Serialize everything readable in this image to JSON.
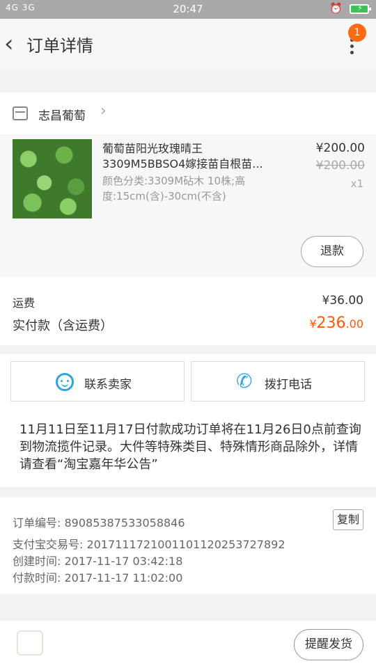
{
  "status_bar": {
    "signal": "4G 3G",
    "time": "20:47"
  },
  "header": {
    "title": "订单详情",
    "badge": "1"
  },
  "shop": {
    "name": "志昌葡萄"
  },
  "product": {
    "name": "葡萄苗阳光玫瑰晴王3309M5BBSO4嫁接苗自根苗...",
    "spec": "颜色分类:3309M砧木 10株;高度:15cm(含)-30cm(不含)",
    "price": "¥200.00",
    "original_price": "¥200.00",
    "quantity": "x1",
    "refund_label": "退款"
  },
  "fees": {
    "shipping_label": "运费",
    "shipping_value": "¥36.00",
    "paid_label": "实付款（含运费）",
    "paid_currency": "¥",
    "paid_int": "236",
    "paid_dec": ".00"
  },
  "contact": {
    "seller_label": "联系卖家",
    "call_label": "拨打电话",
    "notice": "11月11日至11月17日付款成功订单将在11月26日0点前查询到物流揽件记录。大件等特殊类目、特殊情形商品除外，详情请查看“淘宝嘉年华公告”"
  },
  "order_info": {
    "order_no": "订单编号: 89085387533058846",
    "copy_label": "复制",
    "alipay_no": "支付宝交易号: 2017111721001101120253727892",
    "created": "创建时间: 2017-11-17 03:42:18",
    "paid_time": "付款时间: 2017-11-17 11:02:00"
  },
  "bottom": {
    "remind_label": "提醒发货"
  },
  "colors": {
    "accent": "#ff5a00",
    "link_blue": "#2aa7e0",
    "badge": "#ff6a14"
  },
  "icons": [
    "back-arrow-icon",
    "more-icon",
    "store-icon",
    "chevron-right-icon",
    "smile-chat-icon",
    "phone-icon",
    "alarm-icon",
    "battery-icon",
    "app-logo-icon"
  ]
}
